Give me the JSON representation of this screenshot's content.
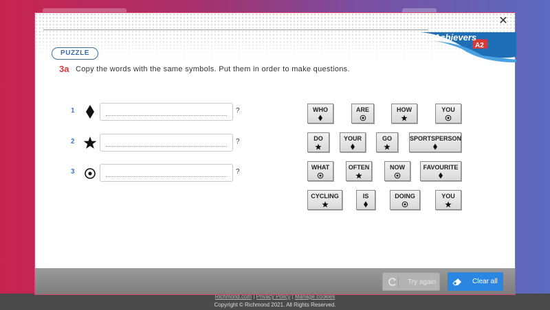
{
  "background": {
    "footer_links": [
      "Richmond.com",
      "Privacy Policy",
      "Manage cookies"
    ],
    "link_separator": "|",
    "copyright": "Copyright © Richmond 2021. All Rights Reserved."
  },
  "modal": {
    "close_symbol": "✕",
    "brand": {
      "name": "Achievers",
      "level": "A2"
    },
    "badge": "PUZZLE",
    "exercise_number": "3a",
    "instruction": "Copy the words with the same symbols. Put them in order to make questions.",
    "questions": [
      {
        "number": "1",
        "symbol": "diamond-icon",
        "value": "",
        "suffix": "?"
      },
      {
        "number": "2",
        "symbol": "star-icon",
        "value": "",
        "suffix": "?"
      },
      {
        "number": "3",
        "symbol": "circle-dot-icon",
        "value": "",
        "suffix": "?"
      }
    ],
    "tiles": [
      {
        "word": "WHO",
        "symbol": "diamond-icon"
      },
      {
        "word": "ARE",
        "symbol": "circle-dot-icon"
      },
      {
        "word": "HOW",
        "symbol": "star-icon"
      },
      {
        "word": "YOU",
        "symbol": "circle-dot-icon"
      },
      {
        "word": "DO",
        "symbol": "star-icon"
      },
      {
        "word": "YOUR",
        "symbol": "diamond-icon"
      },
      {
        "word": "GO",
        "symbol": "star-icon"
      },
      {
        "word": "SPORTSPERSON",
        "symbol": "diamond-icon"
      },
      {
        "word": "WHAT",
        "symbol": "circle-dot-icon"
      },
      {
        "word": "OFTEN",
        "symbol": "star-icon"
      },
      {
        "word": "NOW",
        "symbol": "circle-dot-icon"
      },
      {
        "word": "FAVOURITE",
        "symbol": "diamond-icon"
      },
      {
        "word": "CYCLING",
        "symbol": "star-icon"
      },
      {
        "word": "IS",
        "symbol": "diamond-icon"
      },
      {
        "word": "DOING",
        "symbol": "circle-dot-icon"
      },
      {
        "word": "YOU",
        "symbol": "star-icon"
      }
    ],
    "buttons": {
      "try_again": "Try again",
      "clear_all": "Clear all"
    }
  },
  "colors": {
    "accent_red": "#d43a3a",
    "accent_blue": "#3a7bd5",
    "clear_button": "#2a86e0",
    "modal_border": "#e0466f"
  }
}
